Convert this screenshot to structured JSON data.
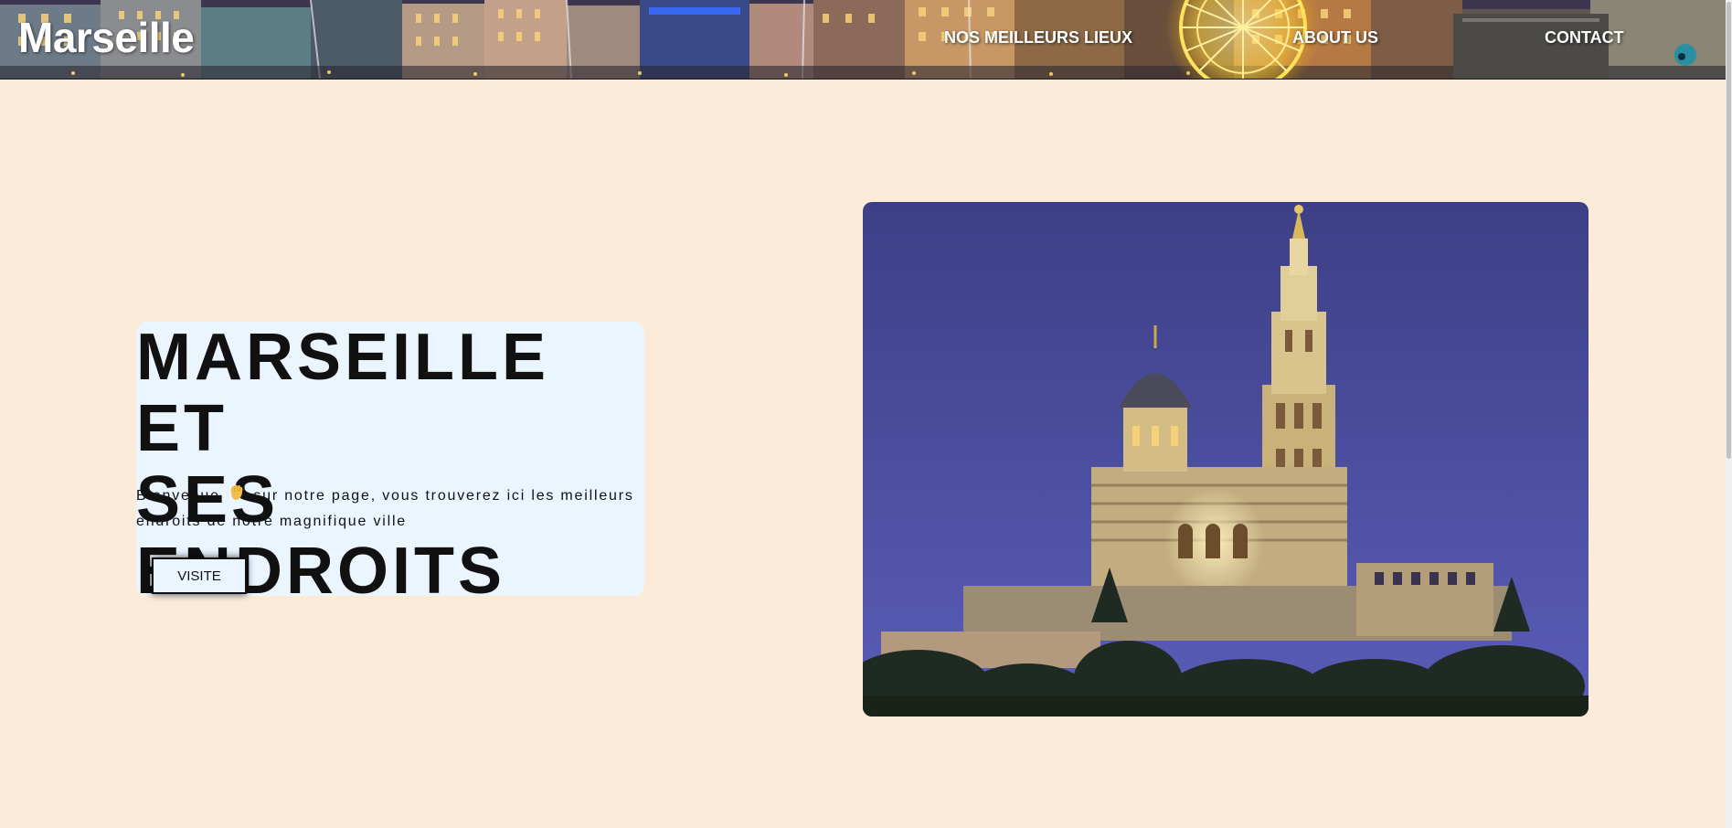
{
  "header": {
    "logo": "Marseille",
    "nav": [
      {
        "label": "NOS MEILLEURS LIEUX"
      },
      {
        "label": "ABOUT US"
      },
      {
        "label": "CONTACT"
      }
    ],
    "banner_image": "Marseille Vieux-Port at night with ferris wheel",
    "colors": {
      "text": "#ffffff"
    }
  },
  "hero": {
    "title": "MARSEILLE ET\nSES ENDROITS",
    "intro_before": "Bienvenue",
    "intro_icon": "waving-hand-icon",
    "intro_after": "sur notre page, vous trouverez ici les meilleurs endroits de notre magnifique ville",
    "button_label": "VISITE",
    "image": "Notre-Dame de la Garde basilica illuminated at dusk"
  },
  "colors": {
    "page_background": "#fbebd8",
    "card_background": "#ebf5ff",
    "title_text": "#111111"
  }
}
